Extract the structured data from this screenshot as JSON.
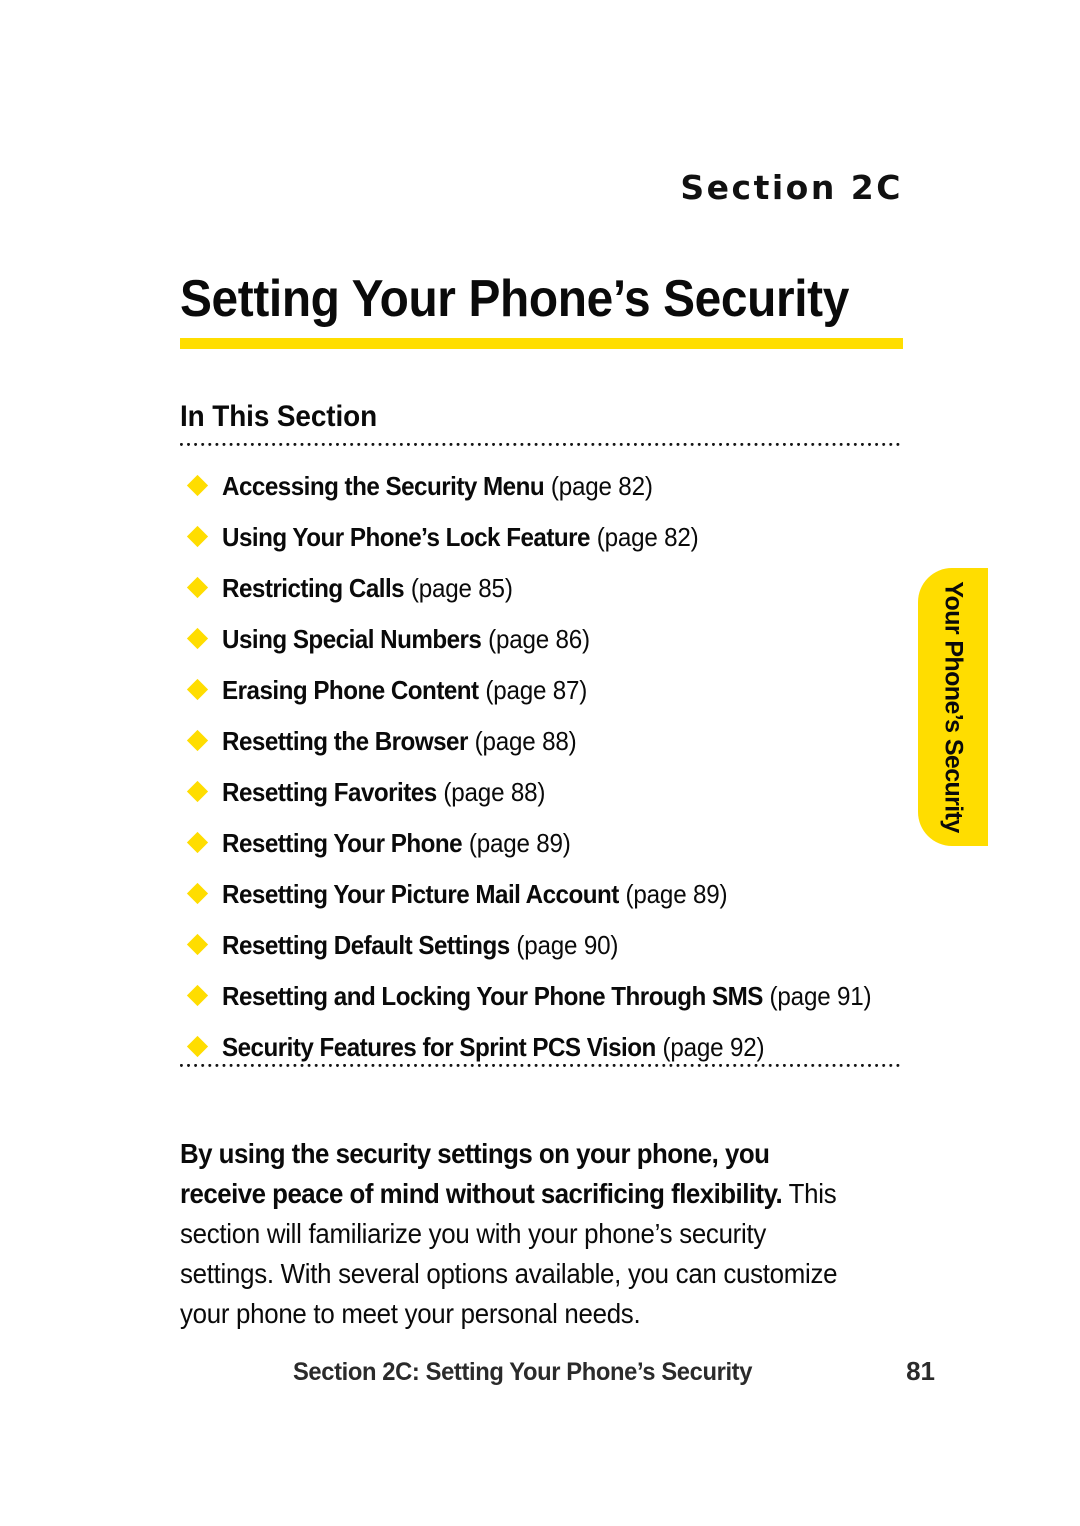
{
  "page": {
    "eyebrow": "Section 2C",
    "title": "Setting Your Phone’s Security",
    "accent_color": "#FFDE00",
    "text_color": "#0A0A0A",
    "background_color": "#FFFFFF"
  },
  "in_this_section": {
    "heading": "In This Section",
    "items": [
      {
        "label": "Accessing the Security Menu",
        "page_ref": "(page 82)"
      },
      {
        "label": "Using Your Phone’s Lock Feature",
        "page_ref": "(page 82)"
      },
      {
        "label": "Restricting Calls",
        "page_ref": "(page 85)"
      },
      {
        "label": "Using Special Numbers",
        "page_ref": "(page 86)"
      },
      {
        "label": "Erasing Phone Content",
        "page_ref": "(page 87)"
      },
      {
        "label": "Resetting the Browser",
        "page_ref": "(page 88)"
      },
      {
        "label": "Resetting Favorites",
        "page_ref": "(page 88)"
      },
      {
        "label": "Resetting Your Phone",
        "page_ref": "(page 89)"
      },
      {
        "label": "Resetting Your Picture Mail Account",
        "page_ref": "(page 89)"
      },
      {
        "label": "Resetting Default Settings",
        "page_ref": "(page 90)"
      },
      {
        "label": "Resetting and Locking Your Phone Through SMS",
        "page_ref": "(page 91)"
      },
      {
        "label": "Security Features for Sprint PCS Vision",
        "page_ref": "(page 92)"
      }
    ]
  },
  "intro": {
    "lead": "By using the security settings on your phone, you receive peace of mind without sacrificing flexibility.",
    "rest": " This section will familiarize you with your phone’s security settings. With several options available, you can customize your phone to meet your personal needs."
  },
  "side_tab": {
    "label": "Your Phone’s Security"
  },
  "footer": {
    "title": "Section 2C: Setting Your Phone’s Security",
    "page_number": "81"
  }
}
